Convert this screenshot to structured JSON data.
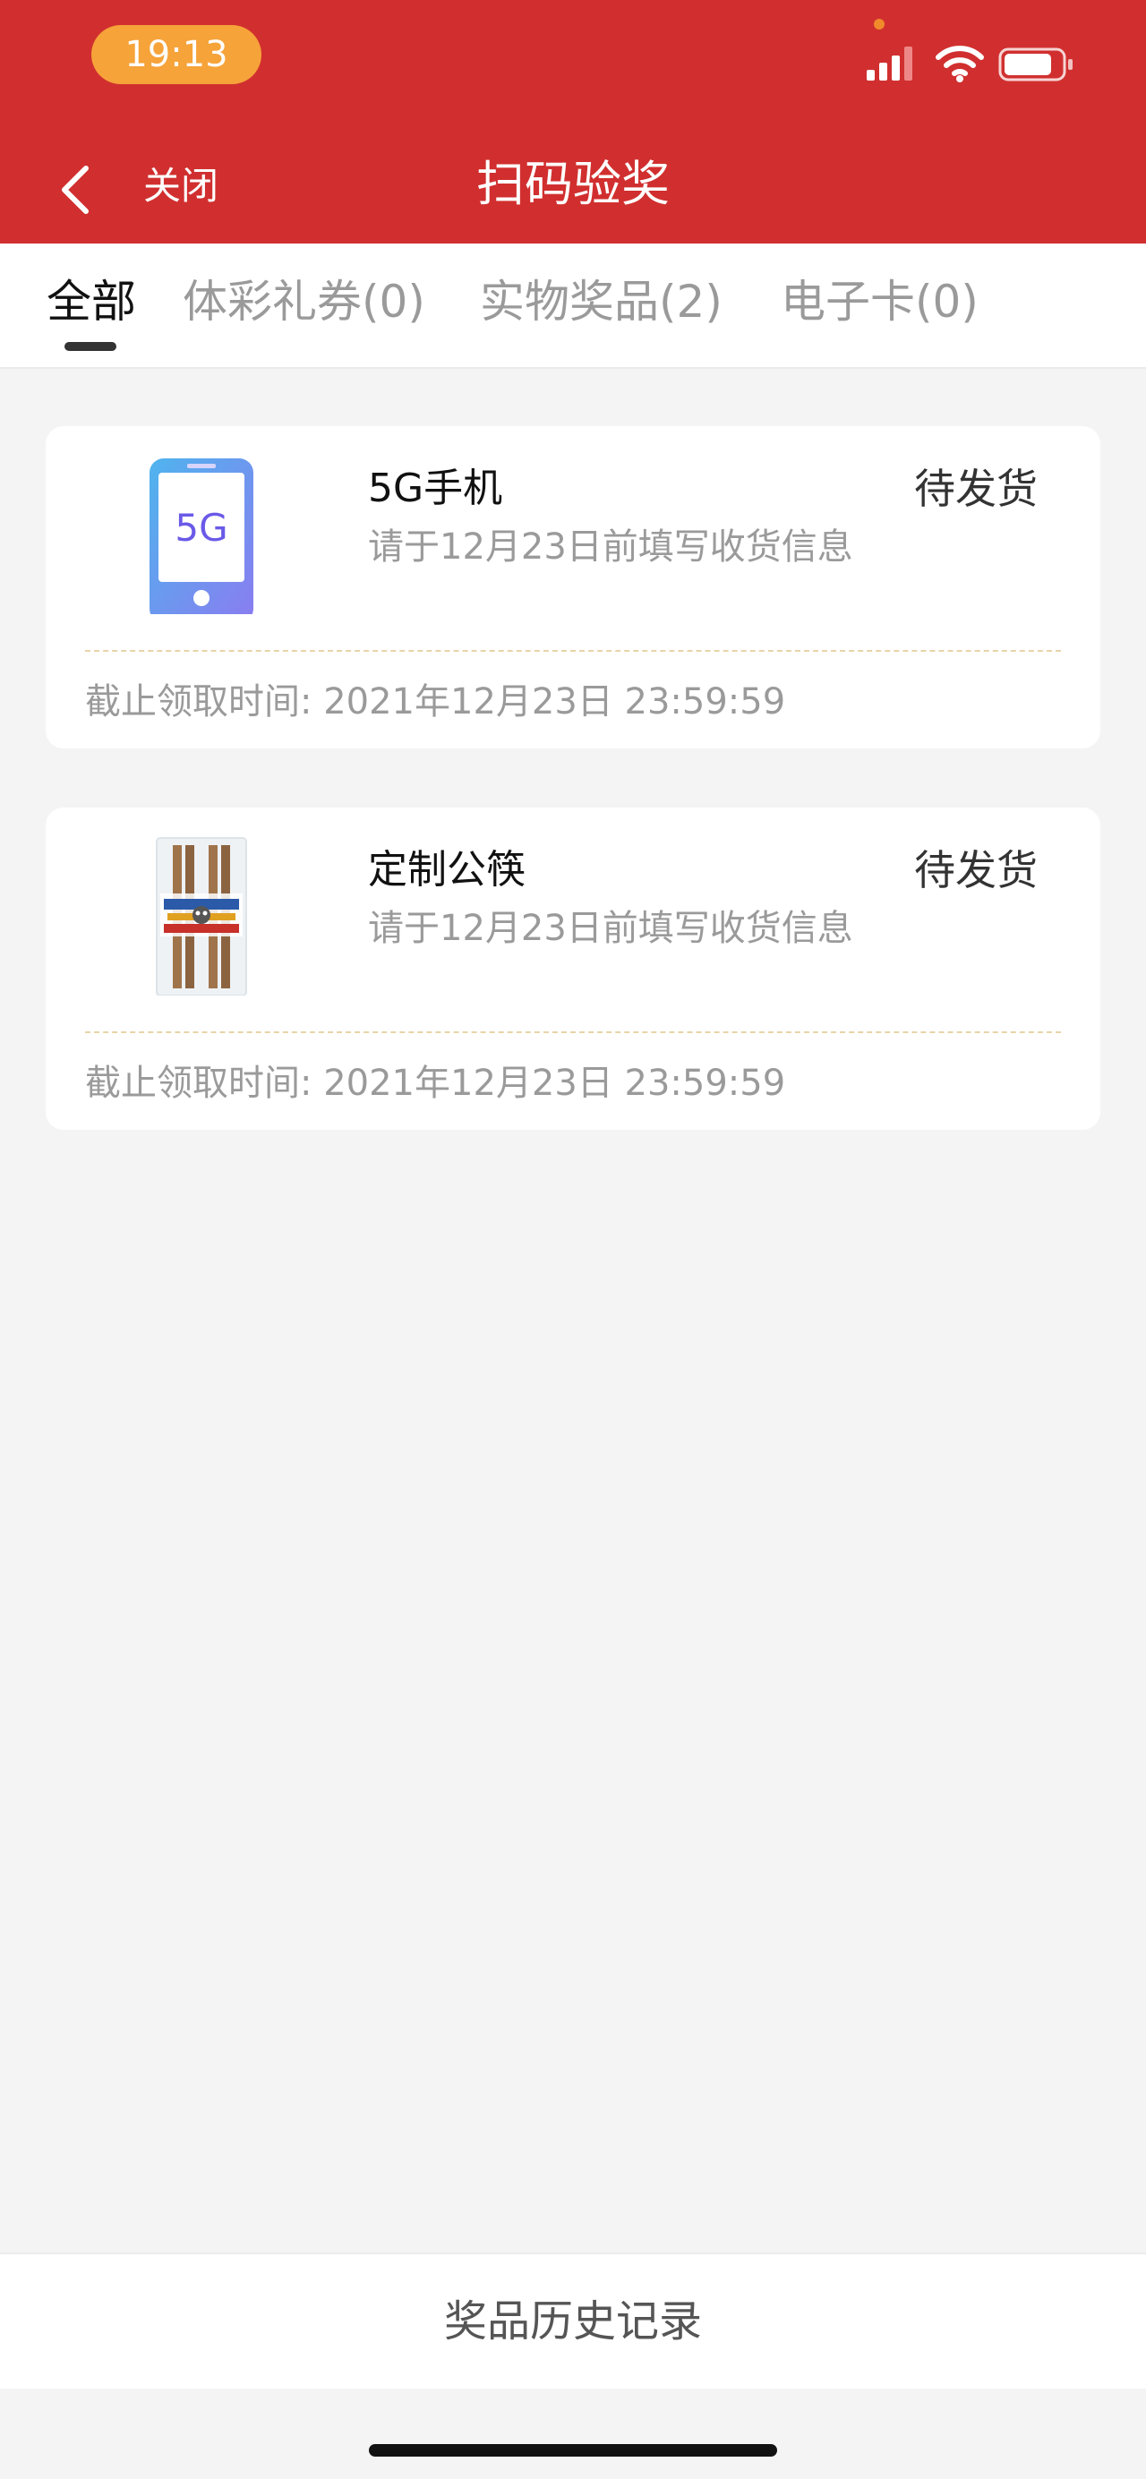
{
  "status_bar": {
    "time": "19:13",
    "icons": [
      "signal-icon",
      "wifi-icon",
      "battery-icon"
    ]
  },
  "nav": {
    "back_icon": "chevron-left-icon",
    "close_label": "关闭",
    "title": "扫码验奖"
  },
  "tabs": [
    {
      "label": "全部",
      "active": true
    },
    {
      "label": "体彩礼券(0)",
      "active": false
    },
    {
      "label": "实物奖品(2)",
      "active": false
    },
    {
      "label": "电子卡(0)",
      "active": false
    }
  ],
  "prizes": [
    {
      "name": "5G手机",
      "status": "待发货",
      "note": "请于12月23日前填写收货信息",
      "deadline_label": "截止领取时间:",
      "deadline": "2021年12月23日 23:59:59",
      "thumb_icon": "phone-5g-icon",
      "thumb_text": "5G"
    },
    {
      "name": "定制公筷",
      "status": "待发货",
      "note": "请于12月23日前填写收货信息",
      "deadline_label": "截止领取时间:",
      "deadline": "2021年12月23日 23:59:59",
      "thumb_icon": "chopsticks-icon"
    }
  ],
  "bottom": {
    "history_label": "奖品历史记录"
  },
  "colors": {
    "header_red": "#d12f2f",
    "time_pill": "#f6a33a",
    "page_bg": "#f4f4f4"
  }
}
